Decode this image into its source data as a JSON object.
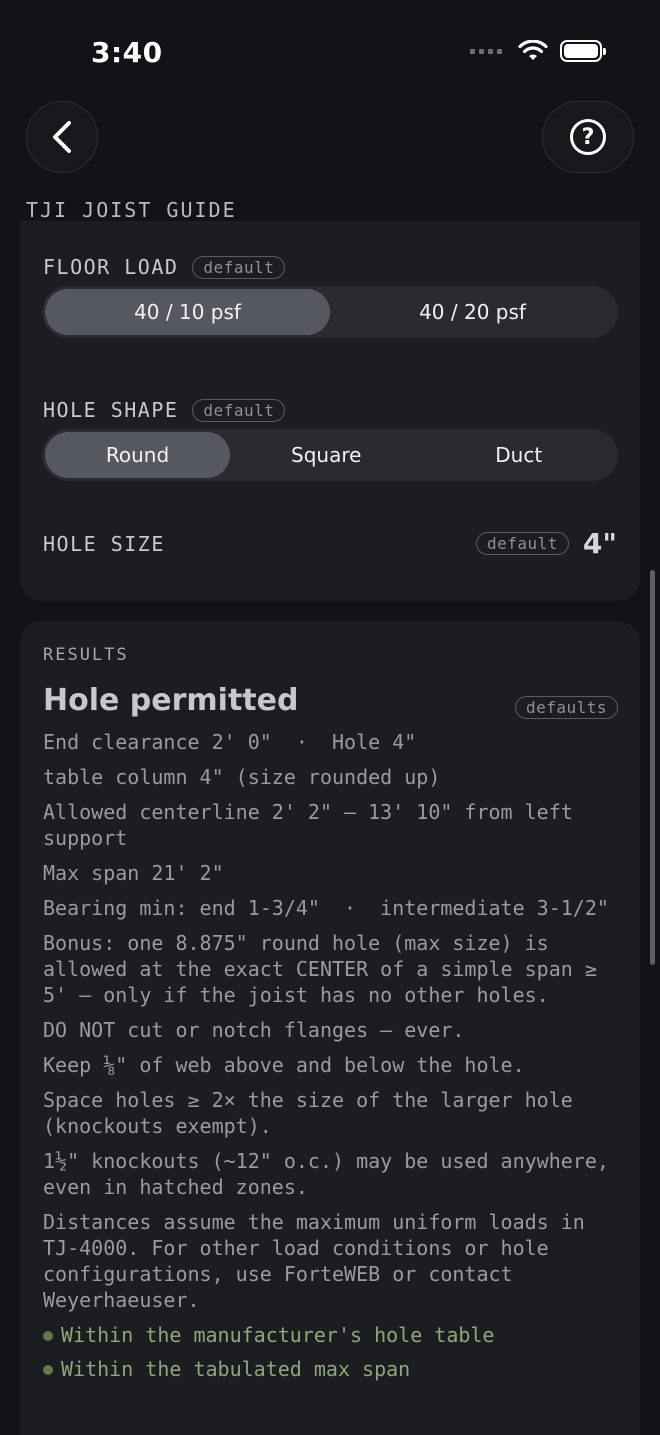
{
  "status_bar": {
    "time": "3:40"
  },
  "header": {
    "title": "TJI JOIST GUIDE"
  },
  "floor_load": {
    "label": "FLOOR LOAD",
    "badge": "default",
    "options": [
      "40 / 10 psf",
      "40 / 20 psf"
    ],
    "selected": "40 / 10 psf"
  },
  "hole_shape": {
    "label": "HOLE SHAPE",
    "badge": "default",
    "options": [
      "Round",
      "Square",
      "Duct"
    ],
    "selected": "Round"
  },
  "hole_size": {
    "label": "HOLE SIZE",
    "badge": "default",
    "value": "4\""
  },
  "results": {
    "label": "RESULTS",
    "verdict": "Hole permitted",
    "badge": "defaults",
    "lines": [
      "End clearance 2' 0\"  ·  Hole 4\"",
      "table column 4\" (size rounded up)",
      "Allowed centerline 2' 2\" — 13' 10\" from left support",
      "Max span 21' 2\"",
      "Bearing min: end 1-3/4\"  ·  intermediate 3-1/2\"",
      "Bonus: one 8.875\" round hole (max size) is allowed at the exact CENTER of a simple span ≥ 5' — only if the joist has no other holes.",
      "DO NOT cut or notch flanges — ever.",
      "Keep ⅛\" of web above and below the hole.",
      "Space holes ≥ 2× the size of the larger hole (knockouts exempt).",
      "1½\" knockouts (~12\" o.c.) may be used anywhere, even in hatched zones.",
      "Distances assume the maximum uniform loads in TJ-4000. For other load conditions or hole configurations, use ForteWEB or contact Weyerhaeuser."
    ],
    "checks": [
      "Within the manufacturer's hole table",
      "Within the tabulated max span"
    ]
  },
  "icons": {
    "back": "chevron-left-icon",
    "help": "question-circle-icon"
  }
}
